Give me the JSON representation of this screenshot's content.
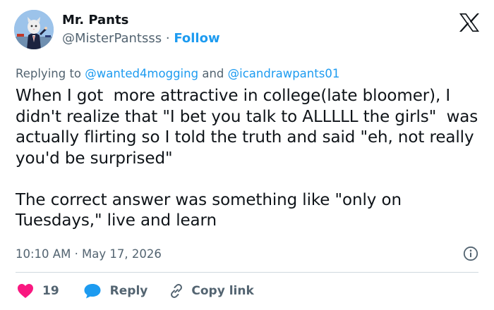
{
  "author": {
    "display_name": "Mr. Pants",
    "handle": "@MisterPantsss",
    "separator": "·",
    "follow_label": "Follow"
  },
  "reply_context": {
    "prefix": "Replying to",
    "mention_1": "@wanted4mogging",
    "connector": "and",
    "mention_2": "@icandrawpants01"
  },
  "tweet": {
    "text": "When I got  more attractive in college(late bloomer), I didn't realize that \"I bet you talk to ALLLLL the girls\"  was actually flirting so I told the truth and said \"eh, not really you'd be surprised\"\n\nThe correct answer was something like \"only on Tuesdays,\" live and learn"
  },
  "meta": {
    "timestamp": "10:10 AM · May 17, 2026"
  },
  "actions": {
    "like_count": "19",
    "reply_label": "Reply",
    "copy_link_label": "Copy link"
  },
  "icons": {
    "logo": "x-logo-icon",
    "info": "info-icon",
    "like": "heart-icon",
    "reply": "speech-bubble-icon",
    "copy": "link-icon"
  },
  "colors": {
    "accent": "#1d9bf0",
    "heart": "#f91880",
    "text": "#0f1419",
    "secondary": "#536471"
  }
}
